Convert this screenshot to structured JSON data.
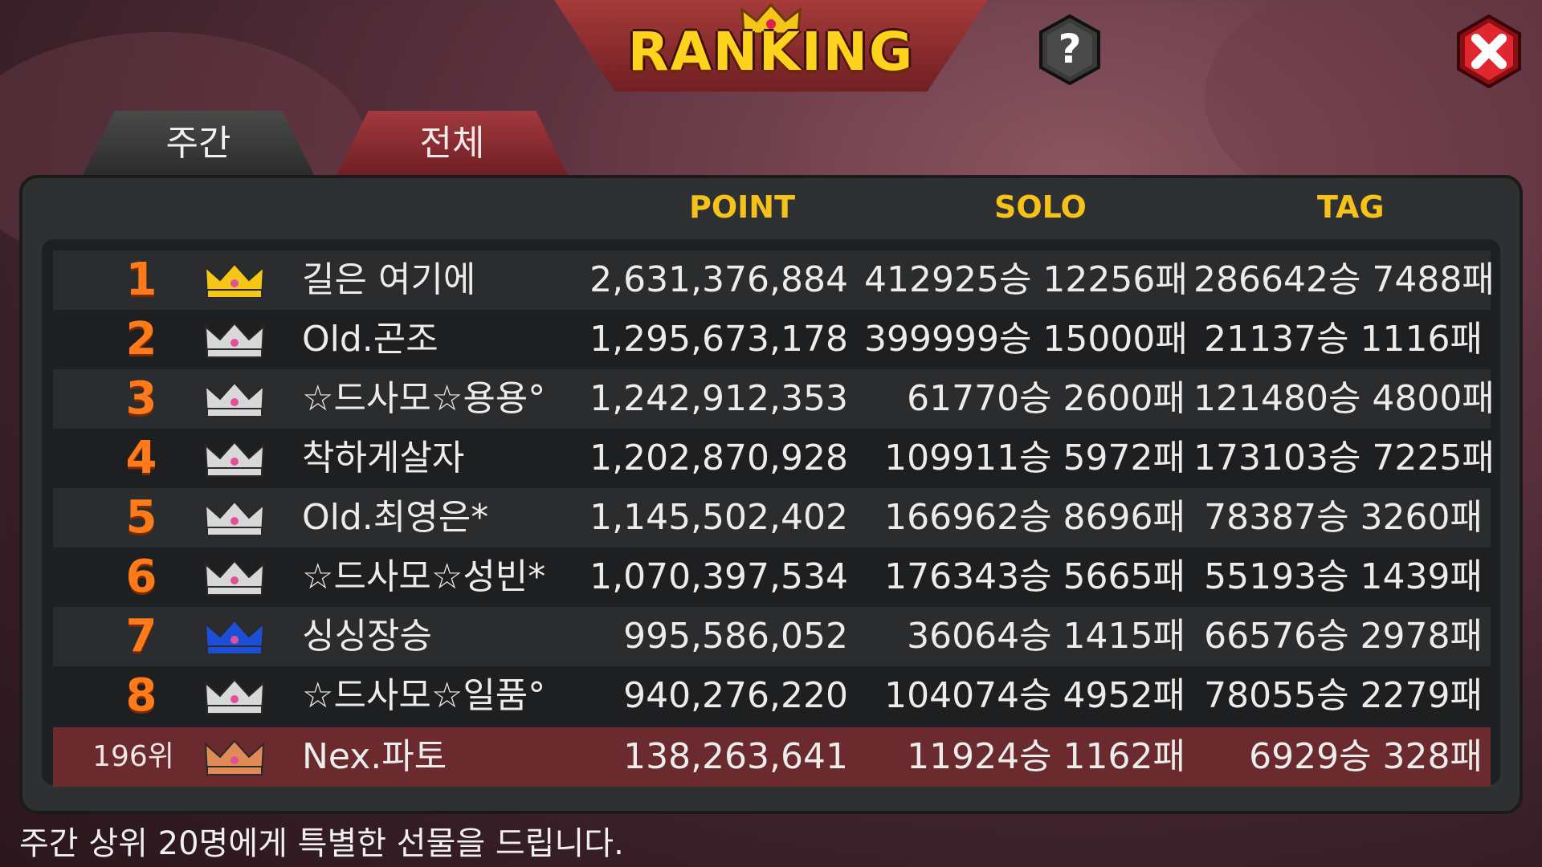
{
  "header": {
    "title": "RANKING",
    "help_label": "?"
  },
  "tabs": [
    {
      "label": "주간",
      "active": true
    },
    {
      "label": "전체",
      "active": false
    }
  ],
  "columns": {
    "point": "POINT",
    "solo": "SOLO",
    "tag": "TAG"
  },
  "rows": [
    {
      "rank": "1",
      "crown": "gold",
      "name": "길은 여기에",
      "point": "2,631,376,884",
      "solo": "412925승 12256패",
      "tag": "286642승 7488패"
    },
    {
      "rank": "2",
      "crown": "silver",
      "name": "Old.곤조",
      "point": "1,295,673,178",
      "solo": "399999승 15000패",
      "tag": "21137승 1116패"
    },
    {
      "rank": "3",
      "crown": "silver",
      "name": "☆드사모☆용용°",
      "point": "1,242,912,353",
      "solo": "61770승 2600패",
      "tag": "121480승 4800패"
    },
    {
      "rank": "4",
      "crown": "silver",
      "name": "착하게살자",
      "point": "1,202,870,928",
      "solo": "109911승 5972패",
      "tag": "173103승 7225패"
    },
    {
      "rank": "5",
      "crown": "silver",
      "name": "Old.최영은*",
      "point": "1,145,502,402",
      "solo": "166962승 8696패",
      "tag": "78387승 3260패"
    },
    {
      "rank": "6",
      "crown": "silver",
      "name": "☆드사모☆성빈*",
      "point": "1,070,397,534",
      "solo": "176343승 5665패",
      "tag": "55193승 1439패"
    },
    {
      "rank": "7",
      "crown": "blue",
      "name": "싱싱장승",
      "point": "995,586,052",
      "solo": "36064승 1415패",
      "tag": "66576승 2978패"
    },
    {
      "rank": "8",
      "crown": "silver",
      "name": "☆드사모☆일품°",
      "point": "940,276,220",
      "solo": "104074승 4952패",
      "tag": "78055승 2279패"
    }
  ],
  "my_row": {
    "rank": "196위",
    "crown": "bronze",
    "name": "Nex.파토",
    "point": "138,263,641",
    "solo": "11924승 1162패",
    "tag": "6929승 328패"
  },
  "footer": "주간 상위 20명에게 특별한 선물을 드립니다.",
  "colors": {
    "gold": "#f5c518",
    "silver": "#d8d8d8",
    "blue": "#1d4fd6",
    "bronze": "#e08a55",
    "header_text": "#f6c21a",
    "rank_number": "#ff7a1a"
  }
}
